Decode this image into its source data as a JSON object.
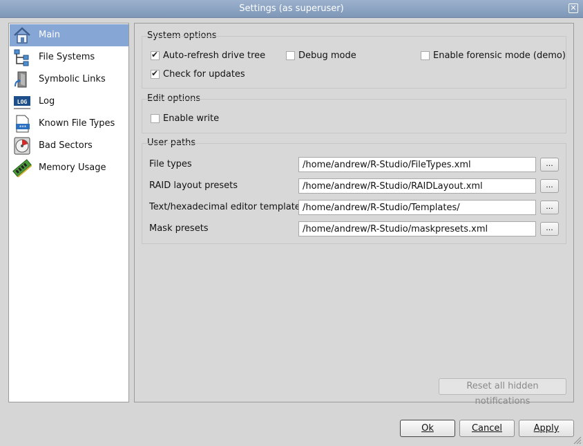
{
  "window": {
    "title": "Settings (as superuser)",
    "close_glyph": "✕"
  },
  "sidebar": {
    "items": [
      {
        "label": "Main",
        "icon": "home-icon",
        "selected": true
      },
      {
        "label": "File Systems",
        "icon": "file-systems-icon",
        "selected": false
      },
      {
        "label": "Symbolic Links",
        "icon": "symbolic-links-icon",
        "selected": false
      },
      {
        "label": "Log",
        "icon": "log-icon",
        "selected": false
      },
      {
        "label": "Known File Types",
        "icon": "known-file-types-icon",
        "selected": false
      },
      {
        "label": "Bad Sectors",
        "icon": "bad-sectors-icon",
        "selected": false
      },
      {
        "label": "Memory Usage",
        "icon": "memory-usage-icon",
        "selected": false
      }
    ]
  },
  "system_options": {
    "title": "System options",
    "auto_refresh": {
      "label": "Auto-refresh drive tree",
      "checked": true
    },
    "debug_mode": {
      "label": "Debug mode",
      "checked": false
    },
    "forensic_mode": {
      "label": "Enable forensic mode (demo)",
      "checked": false
    },
    "check_updates": {
      "label": "Check for updates",
      "checked": true
    }
  },
  "edit_options": {
    "title": "Edit options",
    "enable_write": {
      "label": "Enable write",
      "checked": false
    }
  },
  "user_paths": {
    "title": "User paths",
    "browse_label": "...",
    "rows": [
      {
        "label": "File types",
        "value": "/home/andrew/R-Studio/FileTypes.xml"
      },
      {
        "label": "RAID layout presets",
        "value": "/home/andrew/R-Studio/RAIDLayout.xml"
      },
      {
        "label": "Text/hexadecimal editor templates",
        "value": "/home/andrew/R-Studio/Templates/"
      },
      {
        "label": "Mask presets",
        "value": "/home/andrew/R-Studio/maskpresets.xml"
      }
    ]
  },
  "reset_hidden_label": "Reset all hidden notifications",
  "buttons": {
    "ok": "Ok",
    "cancel": "Cancel",
    "apply": "Apply"
  },
  "colors": {
    "titlebar": "#8aa2c4",
    "selection": "#86a6d6"
  }
}
